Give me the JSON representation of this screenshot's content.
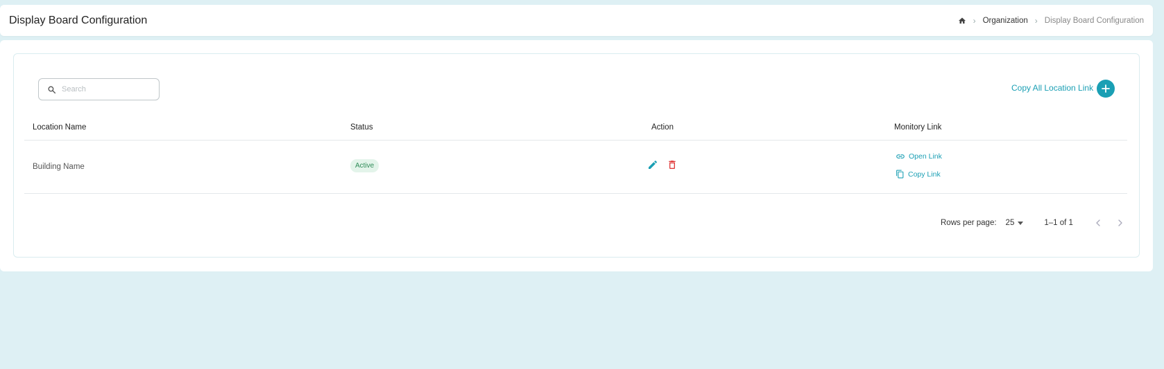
{
  "header": {
    "title": "Display Board Configuration",
    "breadcrumb": {
      "home_icon": "home-icon",
      "items": [
        "Organization",
        "Display Board Configuration"
      ],
      "separator": "›"
    }
  },
  "toolbar": {
    "search_placeholder": "Search",
    "search_value": "",
    "copy_all_label": "Copy All Location Link",
    "add_label": "+"
  },
  "table": {
    "columns": [
      "Location Name",
      "Status",
      "Action",
      "Monitory Link"
    ],
    "rows": [
      {
        "location_name": "Building Name",
        "status": "Active",
        "actions": [
          "edit-icon",
          "delete-icon"
        ],
        "links": {
          "open": "Open Link",
          "copy": "Copy Link"
        }
      }
    ]
  },
  "pagination": {
    "rows_per_page_label": "Rows per page:",
    "rows_per_page_value": "25",
    "range": "1–1 of 1"
  },
  "colors": {
    "accent": "#1a9fb4",
    "background": "#def0f4",
    "status_active_bg": "#e3f4ea",
    "status_active_text": "#2e8b57",
    "delete": "#e03a3a"
  }
}
